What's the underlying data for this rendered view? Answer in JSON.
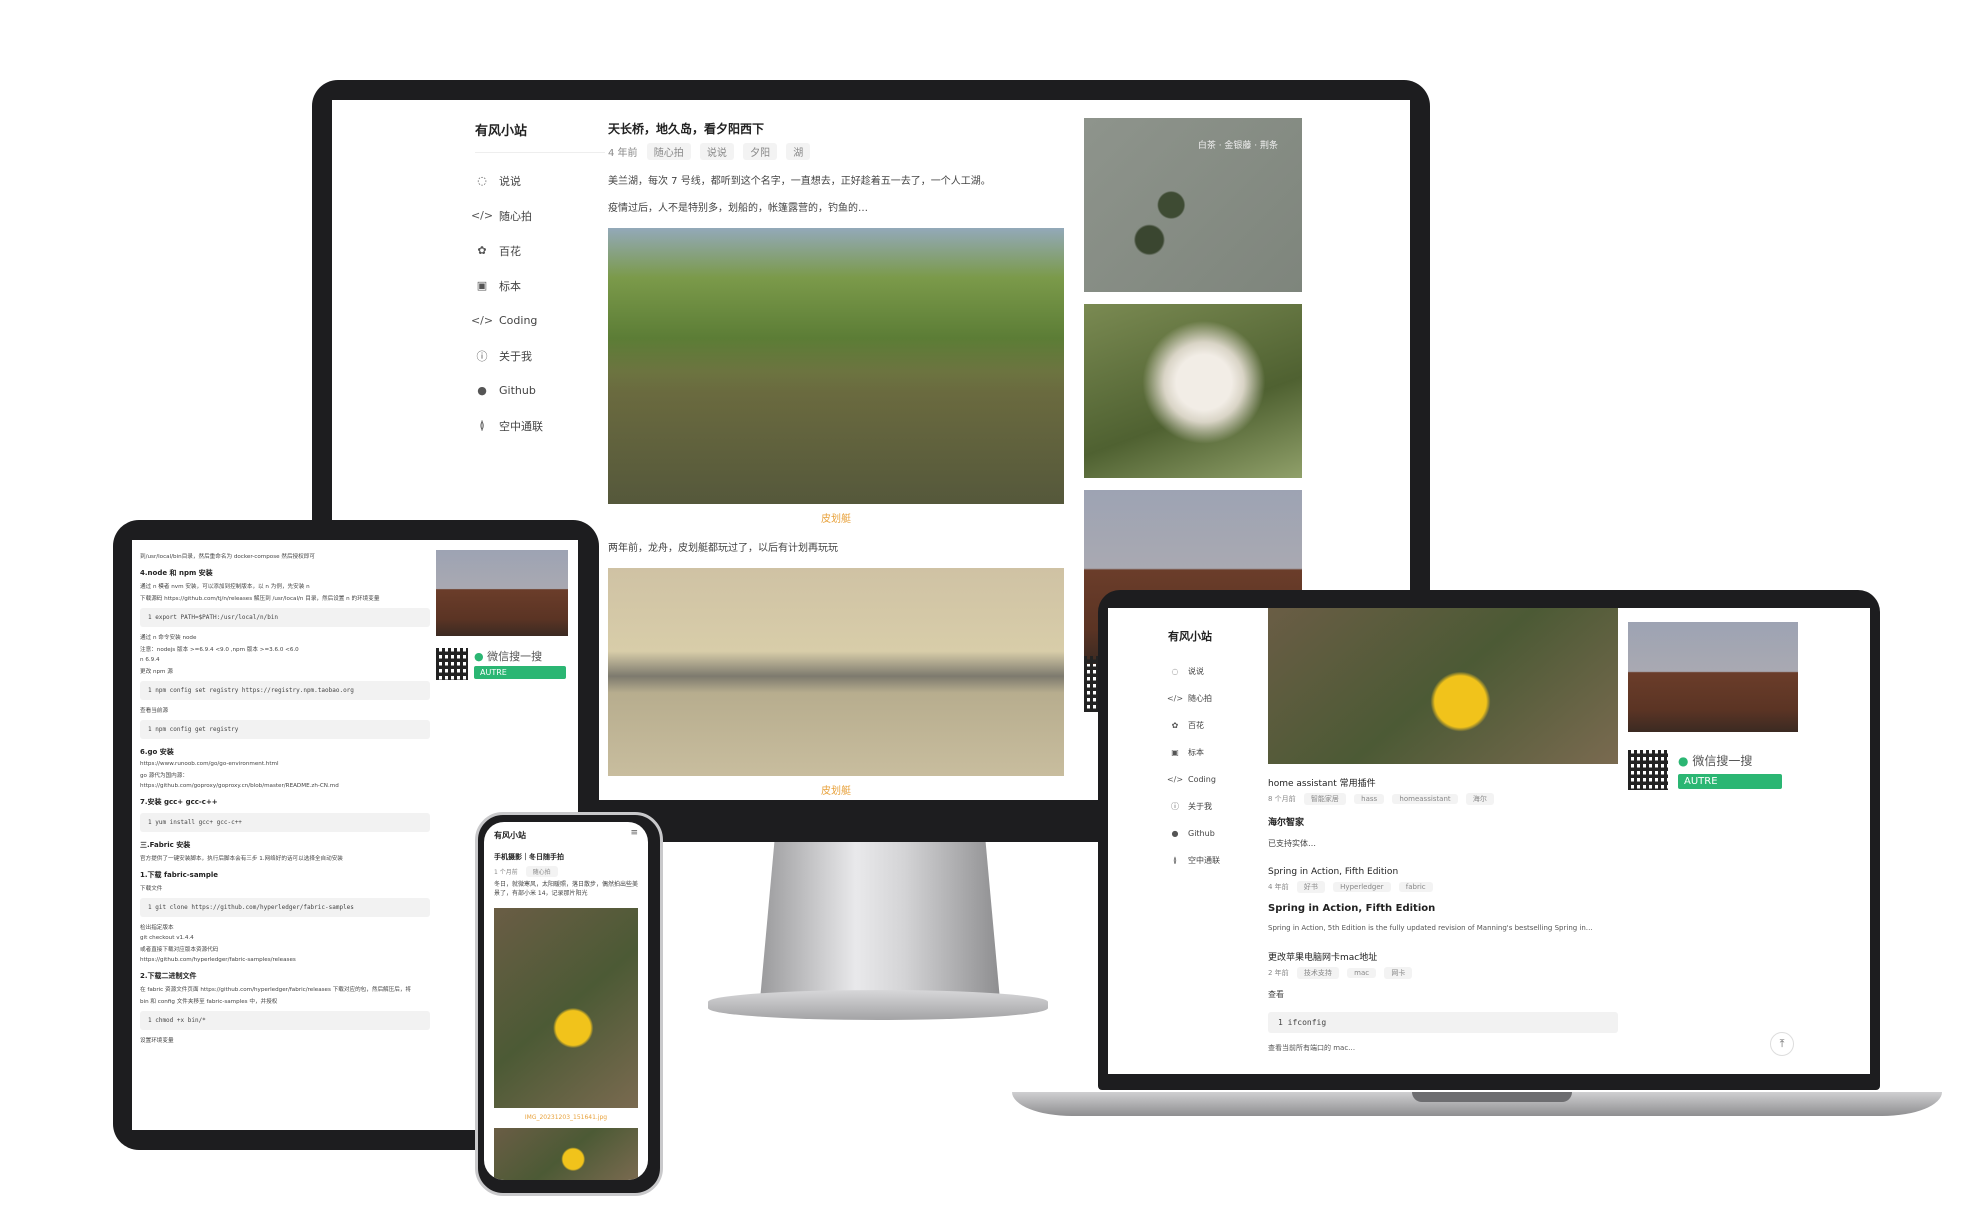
{
  "site": {
    "title": "有风小站"
  },
  "nav": [
    {
      "label": "说说",
      "icon": "chat-icon"
    },
    {
      "label": "随心拍",
      "icon": "code-icon"
    },
    {
      "label": "百花",
      "icon": "flower-icon"
    },
    {
      "label": "标本",
      "icon": "image-icon"
    },
    {
      "label": "Coding",
      "icon": "code-icon"
    },
    {
      "label": "关于我",
      "icon": "info-icon"
    },
    {
      "label": "Github",
      "icon": "github-icon"
    },
    {
      "label": "空中通联",
      "icon": "radio-icon"
    }
  ],
  "desktop": {
    "post_title": "天长桥，地久岛，看夕阳西下",
    "post_time": "4 年前",
    "post_tags": [
      "随心拍",
      "说说",
      "夕阳",
      "湖"
    ],
    "para1": "美兰湖，每次 7 号线，都听到这个名字，一直想去，正好趁着五一去了，一个人工湖。",
    "para2": "疫情过后，人不是特别多，划船的，帐篷露营的，钓鱼的…",
    "caption1": "皮划艇",
    "para3": "两年前，龙舟，皮划艇都玩过了，以后有计划再玩玩",
    "caption2": "皮划艇",
    "side_leaf_text": "白茶 · 金银藤 · 荆条"
  },
  "laptop": {
    "posts": [
      {
        "title": "home assistant 常用插件",
        "time": "8 个月前",
        "tags": [
          "智能家居",
          "hass",
          "homeassistant",
          "海尔"
        ],
        "heading": "海尔智家",
        "excerpt": "已支持实体…"
      },
      {
        "title": "Spring in Action, Fifth Edition",
        "time": "4 年前",
        "tags": [
          "好书",
          "Hyperledger",
          "fabric"
        ],
        "heading": "Spring in Action, Fifth Edition",
        "excerpt": "Spring in Action, 5th Edition is the fully updated revision of Manning's bestselling Spring in…"
      },
      {
        "title": "更改苹果电脑网卡mac地址",
        "time": "2 年前",
        "tags": [
          "技术支持",
          "mac",
          "网卡"
        ],
        "heading": "",
        "excerpt": "查看"
      }
    ],
    "code": "1  ifconfig",
    "tail": "查看当前所有端口的 mac…",
    "wechat_label": "微信搜一搜",
    "wechat_btn": "AUTRE"
  },
  "tablet": {
    "lines": [
      {
        "type": "text",
        "text": "到/usr/local/bin目录，然后重命名为 docker-compose 然后授权即可"
      },
      {
        "type": "head",
        "text": "4.node 和 npm 安装"
      },
      {
        "type": "text",
        "text": "通过 n 模者 nvm 安装，可以添加到控制版本，以 n 为例，先安装 n"
      },
      {
        "type": "text",
        "text": "下载源码 https://github.com/tj/n/releases 解压到 /usr/local/n 目录，然后设置 n 的环境变量"
      },
      {
        "type": "code",
        "text": "1  export PATH=$PATH:/usr/local/n/bin"
      },
      {
        "type": "text",
        "text": "通过 n 命令安装 node"
      },
      {
        "type": "text",
        "text": "注意：nodejs 版本 >=6.9.4 <9.0 ,npm 版本 >=3.6.0 <6.0"
      },
      {
        "type": "text",
        "text": "n 6.9.4"
      },
      {
        "type": "text",
        "text": "更改 npm 源"
      },
      {
        "type": "code",
        "text": "1  npm config set registry https://registry.npm.taobao.org"
      },
      {
        "type": "text",
        "text": "查看当前源"
      },
      {
        "type": "code",
        "text": "1  npm config get registry"
      },
      {
        "type": "head",
        "text": "6.go 安装"
      },
      {
        "type": "text",
        "text": "https://www.runoob.com/go/go-environment.html"
      },
      {
        "type": "text",
        "text": "go 源代为国内源："
      },
      {
        "type": "text",
        "text": "https://github.com/goproxy/goproxy.cn/blob/master/README.zh-CN.md"
      },
      {
        "type": "head",
        "text": "7.安装 gcc+ gcc-c++"
      },
      {
        "type": "code",
        "text": "1  yum install gcc+ gcc-c++"
      },
      {
        "type": "head",
        "text": "三.Fabric 安装"
      },
      {
        "type": "text",
        "text": "官方提供了一键安装脚本，执行后脚本会有三步 1.网络好的话可以选择全自动安装"
      },
      {
        "type": "head",
        "text": "1.下载 fabric-sample"
      },
      {
        "type": "text",
        "text": "下载文件"
      },
      {
        "type": "code",
        "text": "1  git clone https://github.com/hyperledger/fabric-samples"
      },
      {
        "type": "text",
        "text": "检出指定版本"
      },
      {
        "type": "text",
        "text": "git checkout v1.4.4"
      },
      {
        "type": "text",
        "text": "或者直接下载对应版本资源代码"
      },
      {
        "type": "text",
        "text": "https://github.com/hyperledger/fabric-samples/releases"
      },
      {
        "type": "head",
        "text": "2.下载二进制文件"
      },
      {
        "type": "text",
        "text": "在 fabric 资源文件页面 https://github.com/hyperledger/fabric/releases 下载对应的包，然后解压后，将"
      },
      {
        "type": "text",
        "text": "bin 和 config 文件夹移至 fabric-samples 中，并授权"
      },
      {
        "type": "code",
        "text": "1  chmod +x bin/*"
      },
      {
        "type": "text",
        "text": "设置环境变量"
      }
    ],
    "wechat_label": "微信搜一搜",
    "wechat_btn": "AUTRE"
  },
  "phone": {
    "site_title": "有风小站",
    "post_title": "手机摄影｜冬日随手拍",
    "time": "1 个月前",
    "tag": "随心拍",
    "text": "冬日，就微寒风，太阳暖照，落日散步，偶然拍出些美景了，有部小米 14，记录那片阳光",
    "caption": "IMG_20231203_151641.jpg"
  }
}
